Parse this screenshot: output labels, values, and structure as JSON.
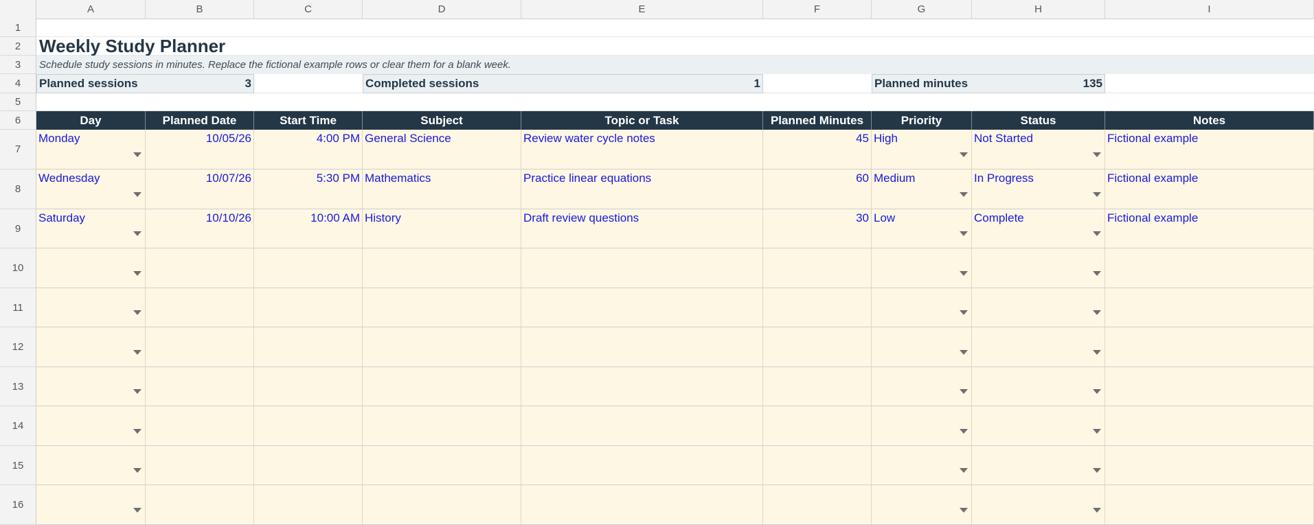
{
  "columns": [
    "A",
    "B",
    "C",
    "D",
    "E",
    "F",
    "G",
    "H",
    "I"
  ],
  "rows": [
    "1",
    "2",
    "3",
    "4",
    "5",
    "6",
    "7",
    "8",
    "9",
    "10",
    "11",
    "12",
    "13",
    "14",
    "15",
    "16"
  ],
  "title": "Weekly Study Planner",
  "subtitle": "Schedule study sessions in minutes. Replace the fictional example rows or clear them for a blank week.",
  "summary": {
    "planned_sessions_label": "Planned sessions",
    "planned_sessions_value": "3",
    "completed_sessions_label": "Completed sessions",
    "completed_sessions_value": "1",
    "planned_minutes_label": "Planned minutes",
    "planned_minutes_value": "135"
  },
  "headers": [
    "Day",
    "Planned Date",
    "Start Time",
    "Subject",
    "Topic or Task",
    "Planned Minutes",
    "Priority",
    "Status",
    "Notes"
  ],
  "table_rows": [
    [
      "Monday",
      "10/05/26",
      "4:00 PM",
      "General Science",
      "Review water cycle notes",
      "45",
      "High",
      "Not Started",
      "Fictional example"
    ],
    [
      "Wednesday",
      "10/07/26",
      "5:30 PM",
      "Mathematics",
      "Practice linear equations",
      "60",
      "Medium",
      "In Progress",
      "Fictional example"
    ],
    [
      "Saturday",
      "10/10/26",
      "10:00 AM",
      "History",
      "Draft review questions",
      "30",
      "Low",
      "Complete",
      "Fictional example"
    ],
    [
      "",
      "",
      "",
      "",
      "",
      "",
      "",
      "",
      ""
    ],
    [
      "",
      "",
      "",
      "",
      "",
      "",
      "",
      "",
      ""
    ],
    [
      "",
      "",
      "",
      "",
      "",
      "",
      "",
      "",
      ""
    ],
    [
      "",
      "",
      "",
      "",
      "",
      "",
      "",
      "",
      ""
    ],
    [
      "",
      "",
      "",
      "",
      "",
      "",
      "",
      "",
      ""
    ],
    [
      "",
      "",
      "",
      "",
      "",
      "",
      "",
      "",
      ""
    ],
    [
      "",
      "",
      "",
      "",
      "",
      "",
      "",
      "",
      ""
    ]
  ],
  "colors": {
    "header_bg": "#243746",
    "input_bg": "#fdf7e4",
    "summary_bg": "#ebf0f3",
    "input_text": "#1a1adf"
  },
  "icons": {
    "dropdown": "dropdown-arrow-icon"
  }
}
